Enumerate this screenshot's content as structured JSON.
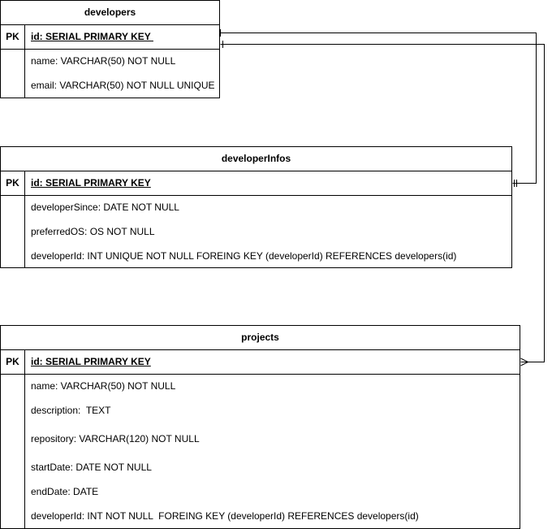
{
  "entities": {
    "developers": {
      "title": "developers",
      "pk_label": "PK",
      "pk_field": "id: SERIAL PRIMARY KEY ",
      "fields": [
        "name: VARCHAR(50) NOT NULL",
        "email: VARCHAR(50) NOT NULL UNIQUE"
      ]
    },
    "developerInfos": {
      "title": "developerInfos",
      "pk_label": "PK",
      "pk_field": "id: SERIAL PRIMARY KEY",
      "fields": [
        "developerSince: DATE NOT NULL",
        "preferredOS: OS NOT NULL",
        "developerId: INT UNIQUE NOT NULL FOREING KEY (developerId) REFERENCES developers(id)"
      ]
    },
    "projects": {
      "title": "projects",
      "pk_label": "PK",
      "pk_field": "id: SERIAL PRIMARY KEY",
      "fields": [
        "name: VARCHAR(50) NOT NULL",
        "description:  TEXT",
        "repository: VARCHAR(120) NOT NULL",
        "startDate: DATE NOT NULL",
        "endDate: DATE",
        "developerId: INT NOT NULL  FOREING KEY (developerId) REFERENCES developers(id)"
      ]
    }
  },
  "relationships": [
    {
      "from": "developers",
      "to": "developerInfos",
      "from_cardinality": "one",
      "to_cardinality": "one-and-only-one"
    },
    {
      "from": "developers",
      "to": "projects",
      "from_cardinality": "one",
      "to_cardinality": "many"
    }
  ],
  "colors": {
    "line": "#000000",
    "background": "#ffffff"
  }
}
